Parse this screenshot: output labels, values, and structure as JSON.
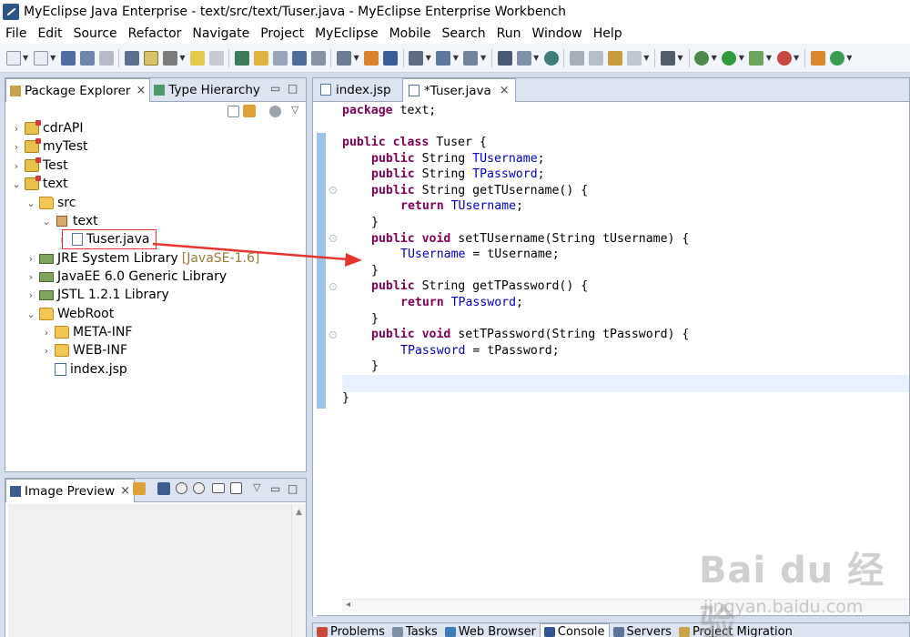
{
  "window": {
    "title": "MyEclipse Java Enterprise - text/src/text/Tuser.java - MyEclipse Enterprise Workbench"
  },
  "menu": [
    "File",
    "Edit",
    "Source",
    "Refactor",
    "Navigate",
    "Project",
    "MyEclipse",
    "Mobile",
    "Search",
    "Run",
    "Window",
    "Help"
  ],
  "package_explorer": {
    "tabs": [
      {
        "label": "Package Explorer",
        "close": "×"
      },
      {
        "label": "Type Hierarchy"
      }
    ],
    "tree": [
      {
        "label": "cdrAPI",
        "icon": "project-icon",
        "expanded": false
      },
      {
        "label": "myTest",
        "icon": "project-icon",
        "expanded": false
      },
      {
        "label": "Test",
        "icon": "project-icon",
        "expanded": false
      },
      {
        "label": "text",
        "icon": "project-icon",
        "expanded": true
      },
      {
        "label": "src",
        "icon": "source-folder-icon",
        "expanded": true
      },
      {
        "label": "text",
        "icon": "package-icon",
        "expanded": true
      },
      {
        "label": "Tuser.java",
        "icon": "java-file-icon",
        "selected": true
      },
      {
        "label": "JRE System Library",
        "suffix": "[JavaSE-1.6]",
        "icon": "library-icon"
      },
      {
        "label": "JavaEE 6.0 Generic Library",
        "icon": "library-icon"
      },
      {
        "label": "JSTL 1.2.1 Library",
        "icon": "library-icon"
      },
      {
        "label": "WebRoot",
        "icon": "folder-icon",
        "expanded": true
      },
      {
        "label": "META-INF",
        "icon": "folder-icon"
      },
      {
        "label": "WEB-INF",
        "icon": "folder-icon"
      },
      {
        "label": "index.jsp",
        "icon": "jsp-file-icon"
      }
    ]
  },
  "image_preview": {
    "tab_label": "Image Preview",
    "close": "×"
  },
  "editor": {
    "tabs": [
      {
        "label": "index.jsp"
      },
      {
        "label": "*Tuser.java",
        "close": "×",
        "active": true
      }
    ],
    "code": {
      "package_kw": "package",
      "package_name": " text;",
      "class_kw": "public class",
      "class_name": " Tuser {",
      "lines": {
        "f1_kw": "public",
        "f1_type": " String ",
        "f1_name": "TUsername",
        "f1_end": ";",
        "f2_kw": "public",
        "f2_type": " String ",
        "f2_name": "TPassword",
        "f2_end": ";",
        "m1_kw": "public",
        "m1_sig": " String getTUsername() {",
        "m1_ret": "return",
        "m1_field": " TUsername",
        "m1_end": ";",
        "close": "}",
        "m2_kw": "public void",
        "m2_sig": " setTUsername(String tUsername) {",
        "m2_field": "TUsername",
        "m2_rhs": " = tUsername;",
        "m3_kw": "public",
        "m3_sig": " String getTPassword() {",
        "m3_ret": "return",
        "m3_field": " TPassword",
        "m3_end": ";",
        "m4_kw": "public void",
        "m4_sig": " setTPassword(String tPassword) {",
        "m4_field": "TPassword",
        "m4_rhs": " = tPassword;"
      }
    }
  },
  "bottom_tabs": [
    "Problems",
    "Tasks",
    "Web Browser",
    "Console",
    "Servers",
    "Project Migration"
  ],
  "watermark": {
    "logo": "Bai du 经验",
    "url": "jingyan.baidu.com"
  },
  "colors": {
    "keyword": "#7f0055",
    "field": "#0000c0",
    "highlight_box": "#e8342e",
    "arrow": "#e8342e"
  }
}
